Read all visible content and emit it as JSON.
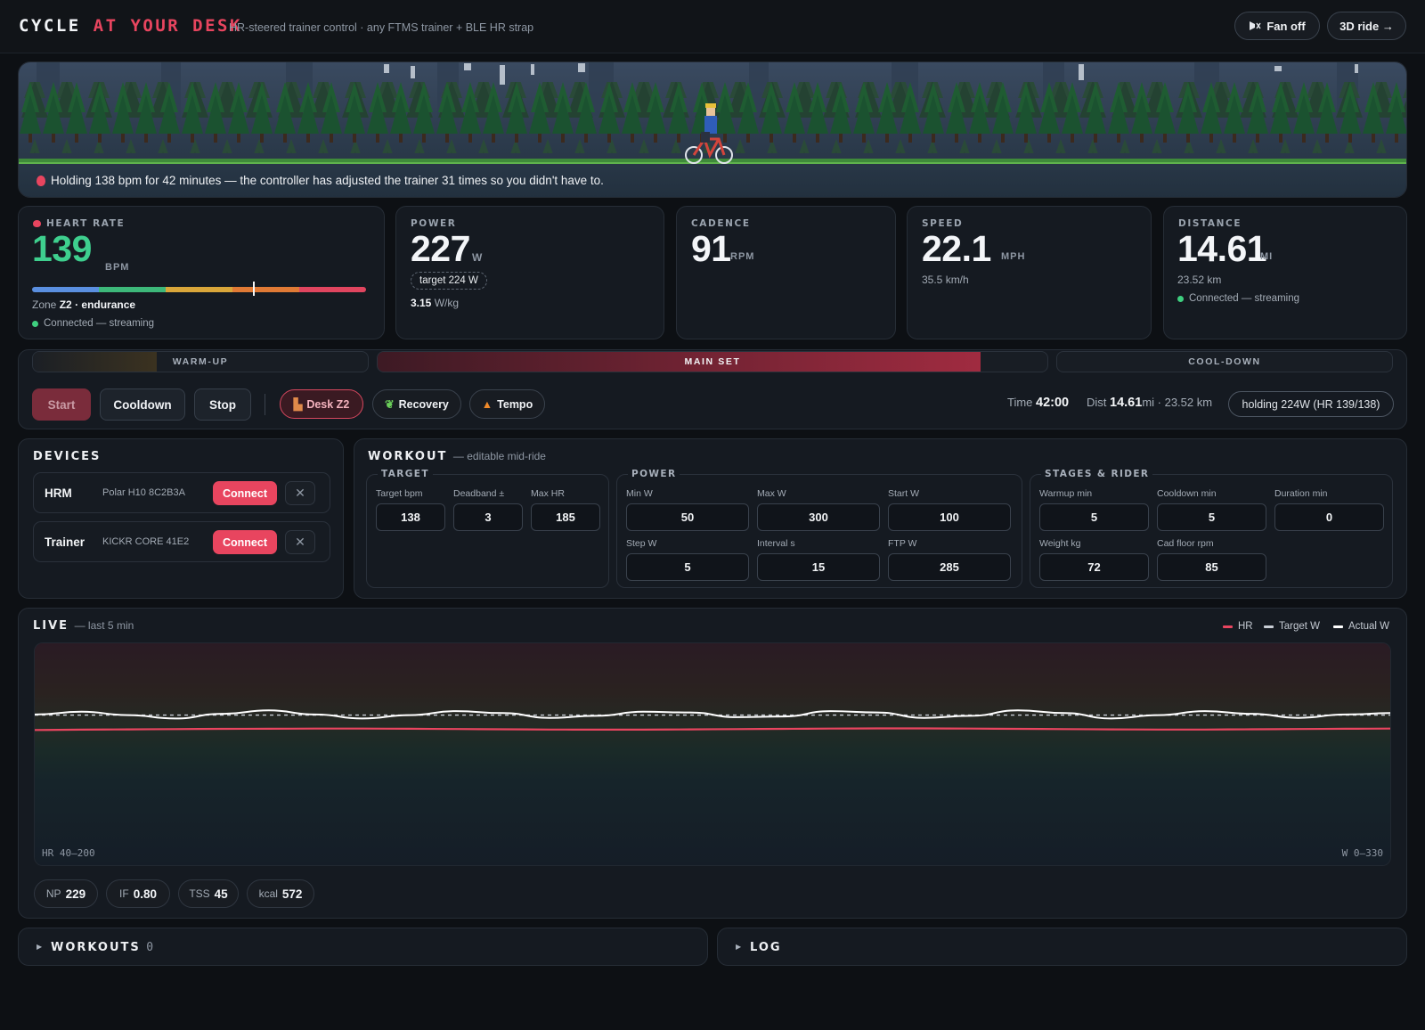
{
  "header": {
    "brand_left": "CYCLE",
    "brand_accent": "AT YOUR DESK",
    "subtitle": "HR-steered trainer control · any FTMS trainer + BLE HR strap",
    "fan_label": "Fan off",
    "ride_label": "3D ride →"
  },
  "scene": {
    "message": "Holding 138 bpm for 42 minutes — the controller has adjusted the trainer 31 times so you didn't have to."
  },
  "stats": {
    "heart_rate": {
      "label": "HEART RATE",
      "value": "139",
      "unit": "BPM",
      "zone_prefix": "Zone",
      "zone": "Z2",
      "zone_name": "· endurance",
      "status": "Connected — streaming",
      "zone_position": 0.66
    },
    "power": {
      "label": "POWER",
      "value": "227",
      "unit": "W",
      "target": "target 224 W",
      "wkg_value": "3.15",
      "wkg_unit": "W/kg"
    },
    "cadence": {
      "label": "CADENCE",
      "value": "91",
      "unit": "RPM"
    },
    "speed": {
      "label": "SPEED",
      "value": "22.1",
      "unit": "MPH",
      "sub": "35.5 km/h"
    },
    "distance": {
      "label": "DISTANCE",
      "value": "14.61",
      "unit": "MI",
      "sub": "23.52 km",
      "status": "Connected — streaming"
    }
  },
  "phases": {
    "warmup": {
      "label": "WARM-UP",
      "progress": 1.0
    },
    "main": {
      "label": "MAIN SET",
      "progress": 0.9
    },
    "cooldown": {
      "label": "COOL-DOWN",
      "progress": 0.0
    }
  },
  "controls": {
    "start": "Start",
    "cooldown": "Cooldown",
    "stop": "Stop",
    "presets": [
      {
        "label": "Desk Z2",
        "icon": "chair-icon",
        "active": true
      },
      {
        "label": "Recovery",
        "icon": "sprout-icon",
        "active": false
      },
      {
        "label": "Tempo",
        "icon": "fire-icon",
        "active": false
      }
    ],
    "time_label": "Time",
    "time_value": "42:00",
    "dist_label": "Dist",
    "dist_value": "14.61",
    "dist_rest": "mi · 23.52 km",
    "holding": "holding 224W (HR 139/138)"
  },
  "devices": {
    "title": "DEVICES",
    "items": [
      {
        "name": "HRM",
        "id": "Polar H10 8C2B3A",
        "connect": "Connect"
      },
      {
        "name": "Trainer",
        "id": "KICKR CORE 41E2",
        "connect": "Connect"
      }
    ]
  },
  "workout": {
    "title": "WORKOUT",
    "subtitle": "— editable mid-ride",
    "target": {
      "legend": "TARGET",
      "fields": [
        {
          "label": "Target bpm",
          "value": "138"
        },
        {
          "label": "Deadband ±",
          "value": "3"
        },
        {
          "label": "Max HR",
          "value": "185"
        }
      ]
    },
    "power": {
      "legend": "POWER",
      "fields": [
        {
          "label": "Min W",
          "value": "50"
        },
        {
          "label": "Max W",
          "value": "300"
        },
        {
          "label": "Start W",
          "value": "100"
        },
        {
          "label": "Step W",
          "value": "5"
        },
        {
          "label": "Interval s",
          "value": "15"
        },
        {
          "label": "FTP W",
          "value": "285"
        }
      ]
    },
    "stages": {
      "legend": "STAGES & RIDER",
      "fields": [
        {
          "label": "Warmup min",
          "value": "5"
        },
        {
          "label": "Cooldown min",
          "value": "5"
        },
        {
          "label": "Duration min",
          "value": "0"
        },
        {
          "label": "Weight kg",
          "value": "72"
        },
        {
          "label": "Cad floor rpm",
          "value": "85"
        }
      ]
    }
  },
  "live": {
    "title": "LIVE",
    "subtitle": "— last 5 min",
    "legend": [
      {
        "name": "HR",
        "color": "#e8455f"
      },
      {
        "name": "Target W",
        "color": "#c9ced6"
      },
      {
        "name": "Actual W",
        "color": "#ffffff"
      }
    ],
    "hr_axis": "HR 40–200",
    "w_axis": "W 0–330",
    "metrics": [
      {
        "label": "NP",
        "value": "229"
      },
      {
        "label": "IF",
        "value": "0.80"
      },
      {
        "label": "TSS",
        "value": "45"
      },
      {
        "label": "kcal",
        "value": "572"
      }
    ]
  },
  "chart_data": {
    "type": "line",
    "title": "",
    "xlabel": "",
    "ylabel": "",
    "x_window_min": 5,
    "axes": {
      "hr_range": [
        40,
        200
      ],
      "w_range": [
        0,
        330
      ]
    },
    "series": [
      {
        "name": "HR",
        "axis": "hr",
        "color": "#e8455f",
        "values": [
          138,
          138.2,
          138.4,
          138.6,
          138.8,
          138.9,
          139,
          139,
          138.9,
          138.7,
          138.5,
          138.3,
          138.2,
          138.2,
          138.4,
          138.6,
          138.8,
          139,
          139.1,
          139.1,
          139,
          138.8,
          138.6,
          138.4,
          138.3,
          138.3,
          138.5,
          138.7,
          138.9,
          139
        ]
      },
      {
        "name": "Target W",
        "axis": "w",
        "color": "#c9ced6",
        "dashed": true,
        "values": [
          224,
          224,
          224,
          224,
          224,
          224,
          224,
          224,
          224,
          224,
          224,
          224,
          224,
          224,
          224,
          224,
          224,
          224,
          224,
          224,
          224,
          224,
          224,
          224,
          224,
          224,
          224,
          224,
          224,
          224
        ]
      },
      {
        "name": "Actual W",
        "axis": "w",
        "color": "#ffffff",
        "values": [
          225,
          229,
          224,
          219,
          226,
          231,
          225,
          219,
          224,
          230,
          227,
          220,
          223,
          229,
          228,
          221,
          222,
          230,
          228,
          220,
          223,
          231,
          227,
          219,
          224,
          230,
          226,
          220,
          225,
          227
        ]
      }
    ]
  },
  "bottom": {
    "workouts_label": "WORKOUTS",
    "workouts_count": "0",
    "log_label": "LOG"
  }
}
